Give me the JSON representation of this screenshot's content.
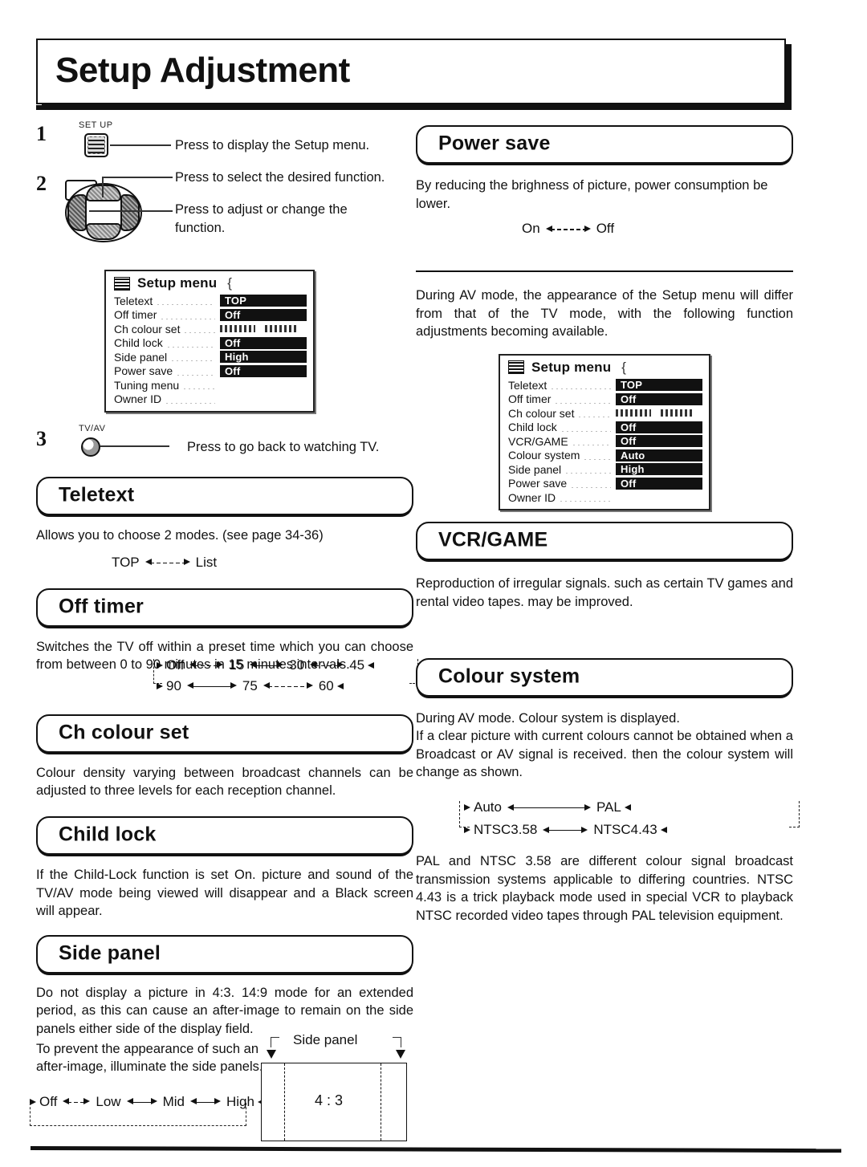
{
  "page": {
    "title": "Setup Adjustment"
  },
  "steps": [
    {
      "number": "1",
      "key_label": "SET UP",
      "key_icon": "setup-button-icon",
      "lines": [
        "Press to display the Setup menu."
      ]
    },
    {
      "number": "2",
      "key_label": "",
      "key_icon": "dpad-cursor-icon",
      "lines": [
        "Press to select the desired function.",
        "Press to adjust or change the function."
      ]
    },
    {
      "number": "3",
      "key_label": "TV/AV",
      "key_icon": "tv-av-button-icon",
      "lines": [
        "Press to go back to watching TV."
      ]
    }
  ],
  "osd_tv": {
    "icon": "menu-icon",
    "header": "Setup menu",
    "rows": [
      {
        "label": "Teletext",
        "value": "TOP",
        "style": "value"
      },
      {
        "label": "Off timer",
        "value": "Off",
        "style": "value"
      },
      {
        "label": "Ch colour set",
        "value": "",
        "style": "bars"
      },
      {
        "label": "Child lock",
        "value": "Off",
        "style": "value"
      },
      {
        "label": "Side panel",
        "value": "High",
        "style": "value"
      },
      {
        "label": "Power save",
        "value": "Off",
        "style": "value"
      },
      {
        "label": "Tuning menu",
        "value": "",
        "style": "none"
      },
      {
        "label": "Owner ID",
        "value": "",
        "style": "none"
      }
    ]
  },
  "osd_av": {
    "icon": "menu-icon",
    "header": "Setup menu",
    "rows": [
      {
        "label": "Teletext",
        "value": "TOP",
        "style": "value"
      },
      {
        "label": "Off timer",
        "value": "Off",
        "style": "value"
      },
      {
        "label": "Ch colour set",
        "value": "",
        "style": "bars"
      },
      {
        "label": "Child lock",
        "value": "Off",
        "style": "value"
      },
      {
        "label": "VCR/GAME",
        "value": "Off",
        "style": "value"
      },
      {
        "label": "Colour system",
        "value": "Auto",
        "style": "value"
      },
      {
        "label": "Side panel",
        "value": "High",
        "style": "value"
      },
      {
        "label": "Power save",
        "value": "Off",
        "style": "value"
      },
      {
        "label": "Owner ID",
        "value": "",
        "style": "none"
      }
    ]
  },
  "sections": {
    "teletext": {
      "title": "Teletext",
      "body": "Allows you to choose 2 modes. (see page 34-36)",
      "cycle": [
        "TOP",
        "List"
      ]
    },
    "off_timer": {
      "title": "Off timer",
      "body": "Switches the TV off within a preset time which you can choose from between 0 to 90 minutes in 15 minutes intervals.",
      "cycle_row1": [
        "Off",
        "15",
        "30",
        "45"
      ],
      "cycle_row2": [
        "90",
        "75",
        "60"
      ]
    },
    "ch_colour_set": {
      "title": "Ch colour set",
      "body": "Colour density varying between broadcast channels can be adjusted to three levels for each reception channel."
    },
    "child_lock": {
      "title": "Child lock",
      "body": "If the Child-Lock function is set On. picture and sound of the TV/AV mode being viewed will disappear and a Black screen will appear."
    },
    "side_panel": {
      "title": "Side panel",
      "body1": "Do not display a picture in 4:3. 14:9 mode for an extended period, as this can cause an after-image to remain on the side panels either side of the display field.",
      "body2": "To prevent the appearance of such an after-image, illuminate the side panels.",
      "cycle": [
        "Off",
        "Low",
        "Mid",
        "High"
      ],
      "figure": {
        "caption": "Side panel",
        "ratio": "4 : 3"
      }
    },
    "power_save": {
      "title": "Power save",
      "body": "By reducing the brighness of picture, power consumption be lower.",
      "cycle": [
        "On",
        "Off"
      ]
    },
    "av_note": "During AV mode, the appearance of the Setup menu will differ from that of the TV mode, with the following function adjustments becoming available.",
    "vcr_game": {
      "title": "VCR/GAME",
      "body": "Reproduction of irregular signals. such as certain TV games and rental video tapes. may be improved."
    },
    "colour_system": {
      "title": "Colour system",
      "body": "During AV mode. Colour system is displayed.\nIf a clear picture with current colours cannot be obtained when a Broadcast or AV signal is received. then the colour system will change as shown.",
      "cycle_row1": [
        "Auto",
        "PAL"
      ],
      "cycle_row2": [
        "NTSC3.58",
        "NTSC4.43"
      ],
      "footnote": "PAL and NTSC 3.58 are different colour signal broadcast transmission systems applicable to differing countries. NTSC 4.43 is a trick playback mode used in special VCR to playback NTSC recorded video tapes through PAL television equipment."
    }
  }
}
